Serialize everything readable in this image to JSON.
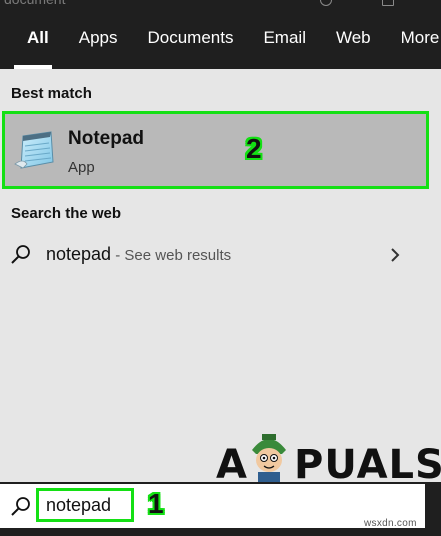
{
  "header": {
    "partial_text": "document",
    "tabs": [
      {
        "label": "All",
        "active": true
      },
      {
        "label": "Apps"
      },
      {
        "label": "Documents"
      },
      {
        "label": "Email"
      },
      {
        "label": "Web"
      },
      {
        "label": "More"
      }
    ]
  },
  "best_match": {
    "heading": "Best match",
    "app_name": "Notepad",
    "app_type": "App",
    "app_icon": "notepad-icon"
  },
  "web": {
    "heading": "Search the web",
    "query": "notepad",
    "suffix": " - See web results",
    "chevron_icon": "chevron-right-icon"
  },
  "search": {
    "value": "notepad",
    "icon": "search-icon"
  },
  "annotations": {
    "step1": "1",
    "step2": "2"
  },
  "watermark": {
    "text": "APPUALS"
  },
  "credit": "wsxdn.com",
  "colors": {
    "highlight": "#14e014",
    "dark_bar": "#1f1f1f",
    "panel": "#e6e6e6",
    "selected": "#b9b9b9"
  }
}
